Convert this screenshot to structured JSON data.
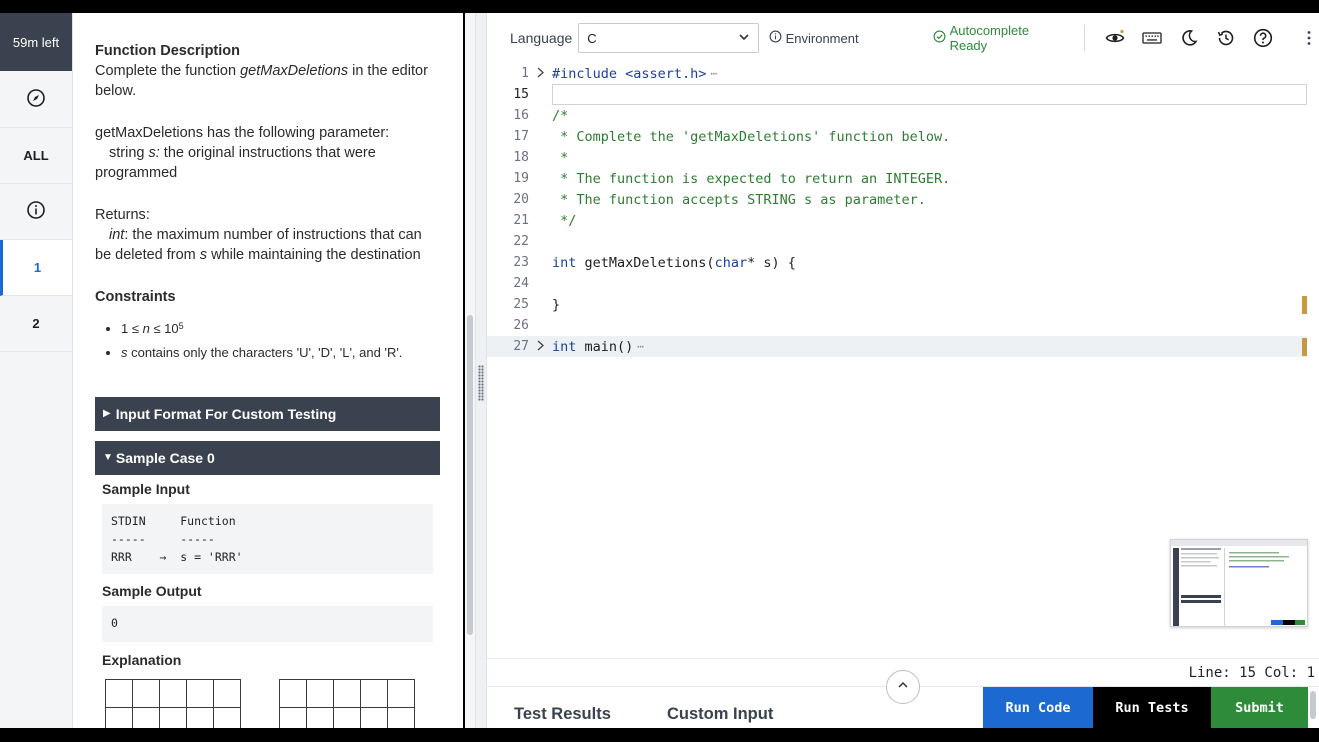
{
  "timer": "59m left",
  "rail": {
    "all_label": "ALL",
    "q1_label": "1",
    "q2_label": "2"
  },
  "problem": {
    "func_desc_heading": "Function Description",
    "func_desc_pre": "Complete the function ",
    "func_name": "getMaxDeletions",
    "func_desc_post": " in the editor below.",
    "param_intro": "getMaxDeletions has the following parameter:",
    "param_type": "string ",
    "param_name": "s:",
    "param_desc": " the original instructions that were programmed",
    "returns_heading": "Returns:",
    "returns_type": "int",
    "returns_desc_1": ": the maximum number of instructions that can be deleted from ",
    "returns_var": "s",
    "returns_desc_2": " while maintaining the destination",
    "constraints_heading": "Constraints",
    "constraint_1_pre": "1 ≤ ",
    "constraint_1_var": "n",
    "constraint_1_mid": " ≤ 10",
    "constraint_1_exp": "5",
    "constraint_2_var": "s",
    "constraint_2_text": " contains only the characters 'U', 'D', 'L', and 'R'.",
    "input_format_label": "Input Format For Custom Testing",
    "sample_case_label": "Sample Case 0",
    "sample_input_label": "Sample Input",
    "sample_input_lines": [
      "STDIN     Function",
      "-----     -----",
      "RRR    →  s = 'RRR'"
    ],
    "sample_output_label": "Sample Output",
    "sample_output_value": "0",
    "explanation_label": "Explanation"
  },
  "toolbar": {
    "language_label": "Language",
    "language_value": "C",
    "environment_label": "Environment",
    "autocomplete_label": "Autocomplete Ready"
  },
  "code": {
    "l1_num": "1",
    "l1_text": "#include <assert.h>",
    "l1_fold": "⋯",
    "l15_num": "15",
    "l16_num": "16",
    "l16_text": "/*",
    "l17_num": "17",
    "l17_text": " * Complete the 'getMaxDeletions' function below.",
    "l18_num": "18",
    "l18_text": " *",
    "l19_num": "19",
    "l19_text": " * The function is expected to return an INTEGER.",
    "l20_num": "20",
    "l20_text": " * The function accepts STRING s as parameter.",
    "l21_num": "21",
    "l21_text": " */",
    "l22_num": "22",
    "l23_num": "23",
    "l23_kw1": "int",
    "l23_mid": " getMaxDeletions(",
    "l23_kw2": "char",
    "l23_end": "* s) {",
    "l24_num": "24",
    "l25_num": "25",
    "l25_text": "}",
    "l26_num": "26",
    "l27_num": "27",
    "l27_kw": "int",
    "l27_text": " main()",
    "l27_fold": "⋯"
  },
  "status": {
    "position": "Line: 15 Col: 1"
  },
  "bottom": {
    "test_results_tab": "Test Results",
    "custom_input_tab": "Custom Input",
    "run_code_label": "Run Code",
    "run_tests_label": "Run Tests",
    "submit_label": "Submit"
  },
  "colors": {
    "accent_blue": "#1c6ad1",
    "submit_green": "#2e8b3a",
    "dark_header": "#39424e"
  }
}
